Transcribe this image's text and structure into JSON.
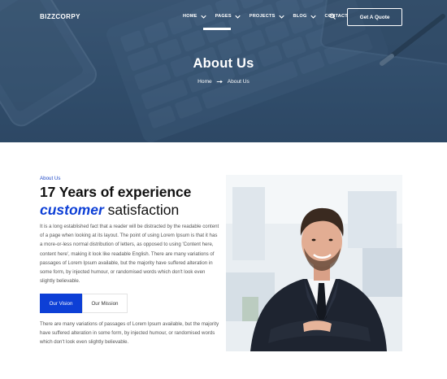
{
  "brand": {
    "logo_text": "BIZZCORPY"
  },
  "nav": {
    "items": [
      {
        "label": "HOME",
        "has_dropdown": true
      },
      {
        "label": "PAGES",
        "has_dropdown": true,
        "active": true
      },
      {
        "label": "PROJECTS",
        "has_dropdown": true
      },
      {
        "label": "BLOG",
        "has_dropdown": true
      },
      {
        "label": "CONTACT",
        "has_dropdown": false
      }
    ],
    "search_icon": "search-icon",
    "cta_label": "Get A Quote"
  },
  "hero": {
    "title": "About Us",
    "breadcrumb": {
      "home": "Home",
      "current": "About Us",
      "separator_icon": "arrow-right-icon"
    }
  },
  "about": {
    "eyebrow": "About Us",
    "heading_line1": "17 Years of experience",
    "heading_accent": "customer",
    "heading_rest": " satisfaction",
    "paragraph1": "It is a long established fact that a reader will be distracted by the readable content of a page when looking at its layout. The point of using Lorem Ipsum is that it has a more-or-less normal distribution of letters, as opposed to using 'Content here, content here', making it look like readable English. There are many variations of passages of Lorem Ipsum available, but the majority have suffered alteration in some form, by injected humour, or randomised words which don't look even slightly believable.",
    "tabs": [
      {
        "label": "Our Vision",
        "active": true
      },
      {
        "label": "Our Mission",
        "active": false
      }
    ],
    "paragraph2": "There are many variations of passages of Lorem Ipsum available, but the majority have suffered alteration in some form, by injected humour, or randomised words which don't look even slightly believable.",
    "photo": "businessman-portrait"
  },
  "colors": {
    "hero_bg": "#34506e",
    "accent_blue": "#0d3fd6",
    "text_dark": "#111111",
    "text_body": "#555555",
    "white": "#ffffff"
  }
}
